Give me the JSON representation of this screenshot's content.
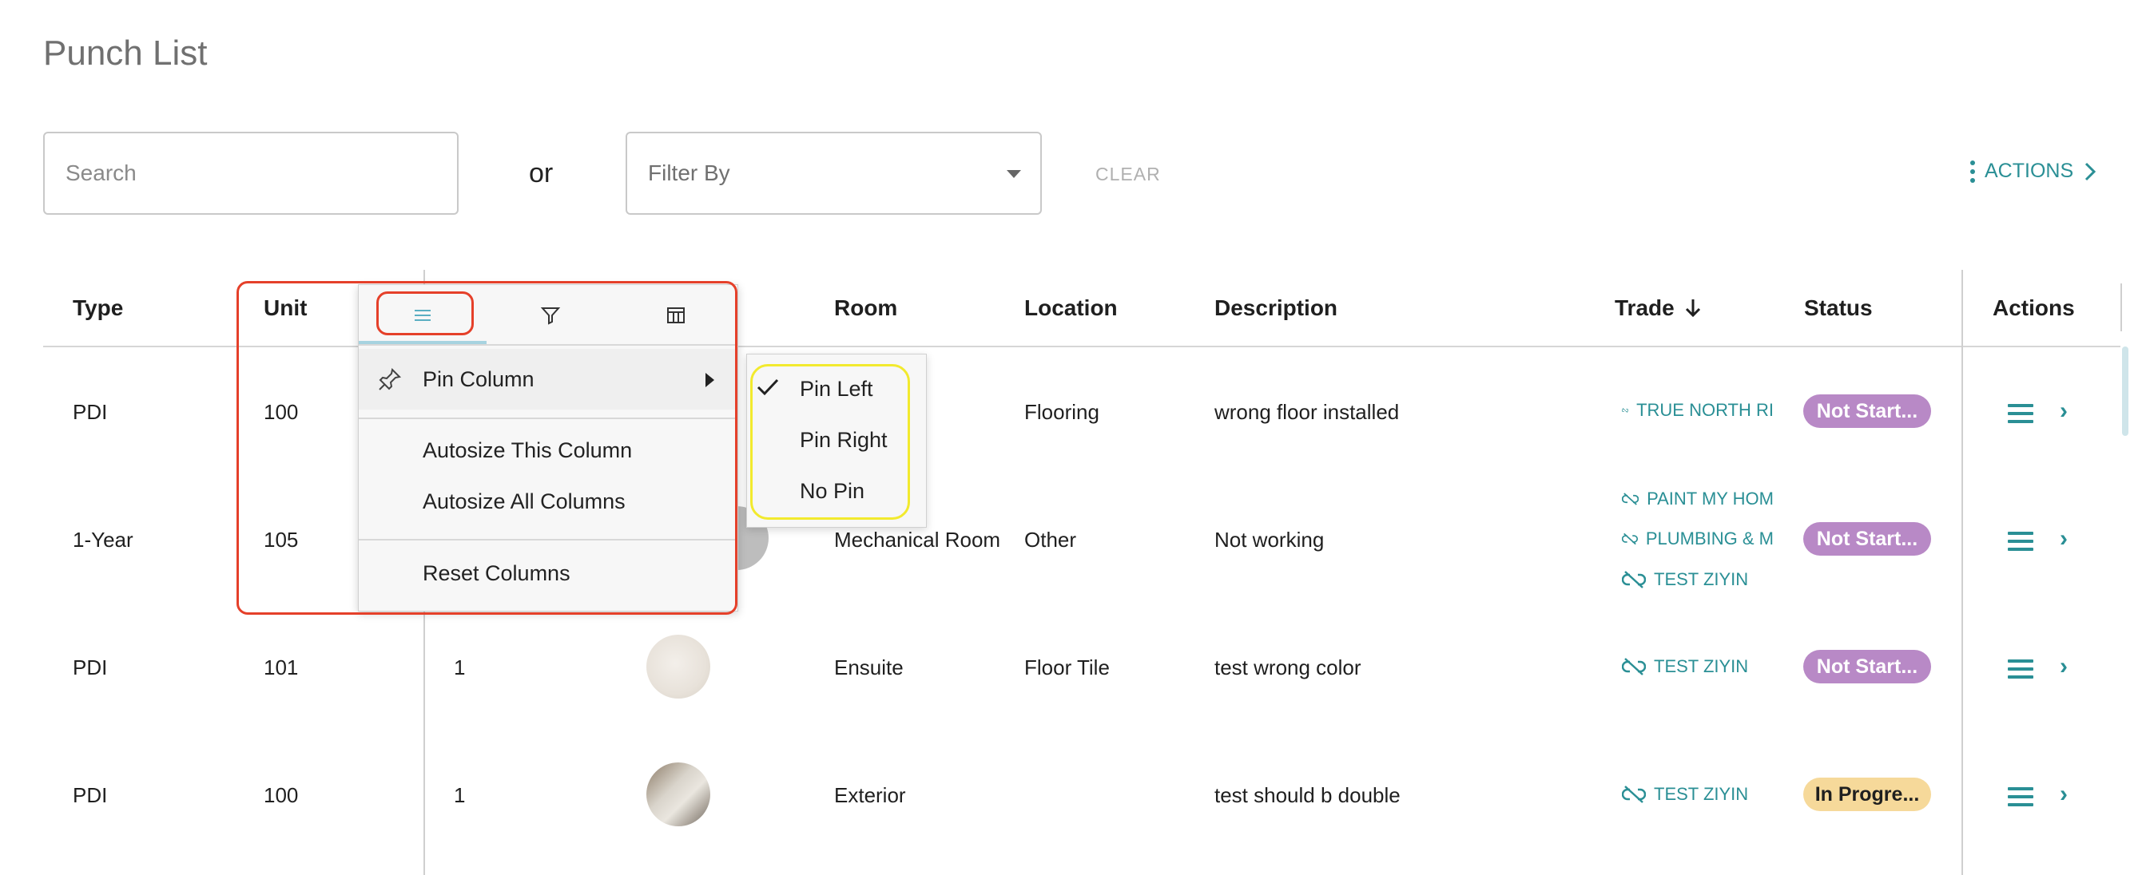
{
  "page": {
    "title": "Punch List",
    "search_placeholder": "Search",
    "or_label": "or",
    "filter_placeholder": "Filter By",
    "clear_label": "CLEAR",
    "actions_label": "ACTIONS"
  },
  "columns": {
    "type": "Type",
    "unit": "Unit",
    "room": "Room",
    "location": "Location",
    "description": "Description",
    "trade": "Trade",
    "status": "Status",
    "actions": "Actions",
    "trade_sort": "descending"
  },
  "rows": [
    {
      "type": "PDI",
      "unit": "100",
      "room": "",
      "location": "Flooring",
      "description": "wrong floor installed",
      "trades": [
        "TRUE NORTH RI"
      ],
      "status": "Not Start..."
    },
    {
      "type": "1-Year",
      "unit": "105",
      "room": "Mechanical Room",
      "location": "Other",
      "description": "Not working",
      "trades": [
        "PAINT MY HOM",
        "PLUMBING & M",
        "TEST ZIYIN"
      ],
      "status": "Not Start..."
    },
    {
      "type": "PDI",
      "unit": "101",
      "qty": "1",
      "room": "Ensuite",
      "location": "Floor Tile",
      "description": "test wrong color",
      "trades": [
        "TEST ZIYIN"
      ],
      "status": "Not Start..."
    },
    {
      "type": "PDI",
      "unit": "100",
      "qty": "1",
      "room": "Exterior",
      "location": "",
      "description": "test should b double",
      "trades": [
        "TEST ZIYIN"
      ],
      "status": "In Progre..."
    }
  ],
  "column_menu": {
    "tabs": [
      "general-icon",
      "filter-icon",
      "columns-icon"
    ],
    "active_tab": "general-icon",
    "pin_column": "Pin Column",
    "autosize_this": "Autosize This Column",
    "autosize_all": "Autosize All Columns",
    "reset_columns": "Reset Columns"
  },
  "pin_submenu": {
    "pin_left": "Pin Left",
    "pin_right": "Pin Right",
    "no_pin": "No Pin",
    "selected": "Pin Left"
  },
  "colors": {
    "accent": "#2a8f95",
    "status_not_started": "#b889c6",
    "status_in_progress": "#f6d99a",
    "highlight_red": "#e5402a",
    "highlight_yellow": "#f2ea2e"
  }
}
